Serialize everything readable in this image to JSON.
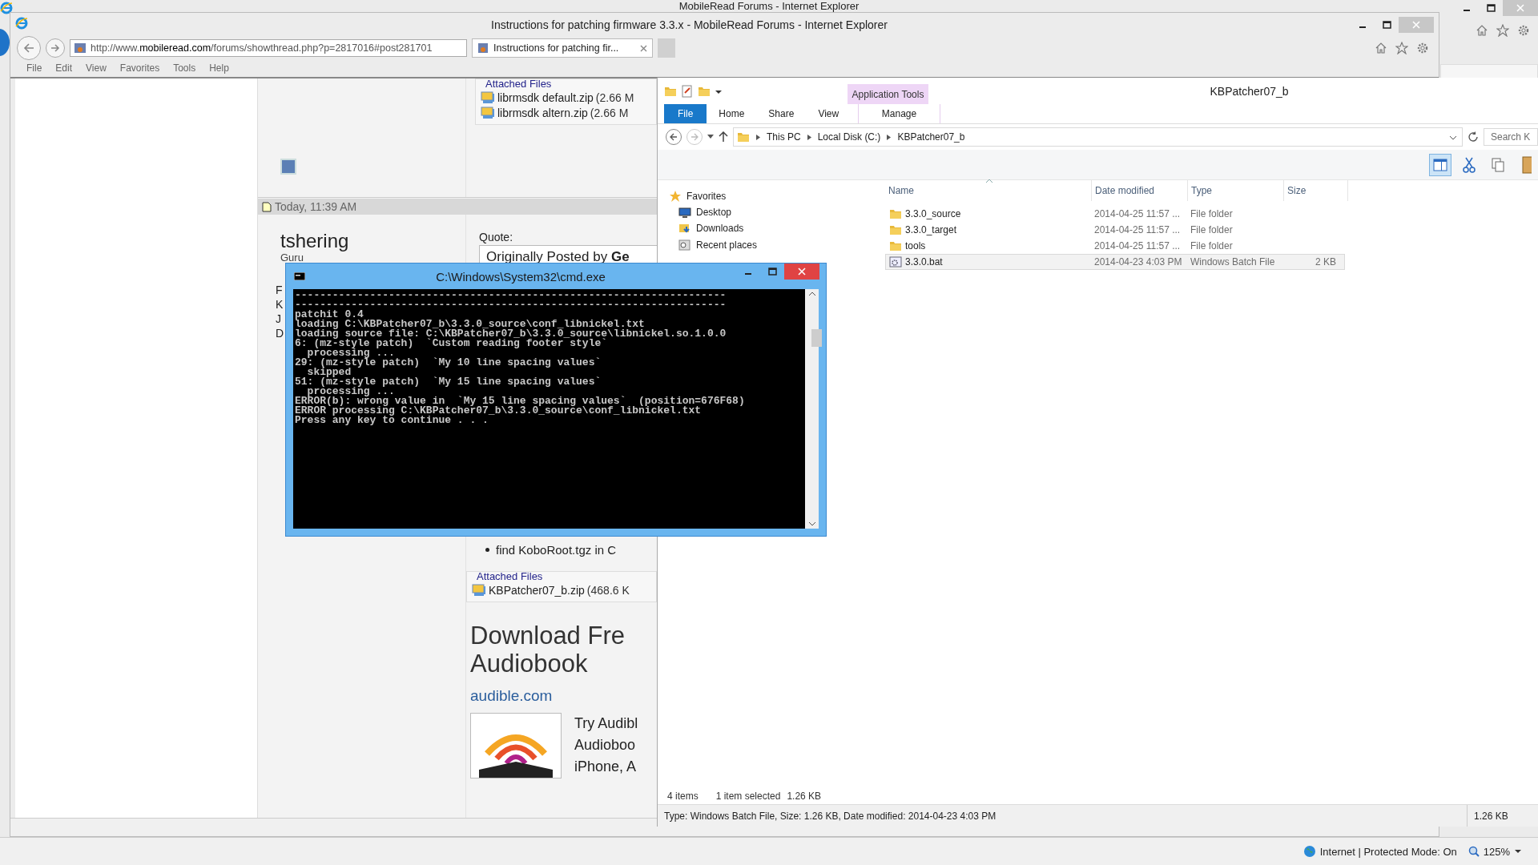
{
  "outer_window": {
    "title": "MobileRead Forums - Internet Explorer",
    "status": "Internet | Protected Mode: On",
    "zoom": "125%"
  },
  "browser": {
    "title": "Instructions for patching firmware 3.3.x - MobileRead Forums - Internet Explorer",
    "address": "http://www.**mobileread.com**/forums/showthread.php?p=2817016#post281701",
    "tabs": [
      {
        "label": "Instructions for patching fir...",
        "selected": true
      }
    ],
    "menu": [
      "File",
      "Edit",
      "View",
      "Favorites",
      "Tools",
      "Help"
    ]
  },
  "page": {
    "post1": {
      "attachments_title": "Attached Files",
      "attachments": [
        {
          "name": "librmsdk default.zip",
          "size": "(2.66 M"
        },
        {
          "name": "librmsdk altern.zip",
          "size": "(2.66 M"
        }
      ]
    },
    "post2": {
      "date": "Today, 11:39 AM",
      "user": "tshering",
      "rank": "Guru",
      "fragments": [
        "F",
        "K",
        "J",
        "D"
      ],
      "quote_label": "Quote:",
      "quote": "Originally Posted by **Ge**",
      "bullet": "find KoboRoot.tgz in C",
      "attachments_title": "Attached Files",
      "attachments": [
        {
          "name": "KBPatcher07_b.zip",
          "size": "(468.6 K"
        }
      ]
    },
    "ad": {
      "heading": [
        "Download Fre",
        "Audiobook"
      ],
      "link": "audible.com",
      "text": [
        "Try Audibl",
        "Audioboo",
        "iPhone, A"
      ]
    }
  },
  "explorer": {
    "title": "KBPatcher07_b",
    "context_tab": "Application Tools",
    "ribbon_tabs": [
      {
        "label": "File",
        "kind": "file"
      },
      {
        "label": "Home",
        "kind": "tab"
      },
      {
        "label": "Share",
        "kind": "tab"
      },
      {
        "label": "View",
        "kind": "tab"
      },
      {
        "label": "Manage",
        "kind": "context"
      }
    ],
    "breadcrumb": [
      "This PC",
      "Local Disk (C:)",
      "KBPatcher07_b"
    ],
    "search": {
      "placeholder": "Search K"
    },
    "toolbar": [
      {
        "kind": "preview",
        "selected": true
      },
      {
        "kind": "cut",
        "selected": false
      },
      {
        "kind": "copy",
        "selected": false
      },
      {
        "kind": "paste",
        "selected": false
      }
    ],
    "nav": [
      {
        "label": "Favorites",
        "kind": "favorites",
        "children": [
          {
            "label": "Desktop",
            "kind": "desktop"
          },
          {
            "label": "Downloads",
            "kind": "downloads"
          },
          {
            "label": "Recent places",
            "kind": "recent"
          }
        ]
      }
    ],
    "columns": [
      "Name",
      "Date modified",
      "Type",
      "Size"
    ],
    "files": [
      {
        "name": "3.3.0_source",
        "date": "2014-04-25 11:57 ...",
        "type": "File folder",
        "kind": "folder",
        "selected": false
      },
      {
        "name": "3.3.0_target",
        "date": "2014-04-25 11:57 ...",
        "type": "File folder",
        "kind": "folder",
        "selected": false
      },
      {
        "name": "tools",
        "date": "2014-04-25 11:57 ...",
        "type": "File folder",
        "kind": "folder",
        "selected": false
      },
      {
        "name": "3.3.0.bat",
        "date": "2014-04-23 4:03 PM",
        "type": "Windows Batch File",
        "size": "2 KB",
        "kind": "batch",
        "selected": true
      }
    ],
    "status": {
      "count": "4 items",
      "selection": "1 item selected",
      "size": "1.26 KB"
    },
    "details": {
      "text": "Type: Windows Batch File, Size: 1.26 KB, Date modified: 2014-04-23 4:03 PM",
      "size": "1.26 KB"
    }
  },
  "console": {
    "title": "C:\\Windows\\System32\\cmd.exe",
    "lines": [
      "---------------------------------------------------------------------",
      "---------------------------------------------------------------------",
      "patchit 0.4",
      "loading C:\\KBPatcher07_b\\3.3.0_source\\conf_libnickel.txt",
      "loading source file: C:\\KBPatcher07_b\\3.3.0_source\\libnickel.so.1.0.0",
      "6: (mz-style patch)  `Custom reading footer style`",
      "  processing ...",
      "29: (mz-style patch)  `My 10 line spacing values`",
      "  skipped",
      "51: (mz-style patch)  `My 15 line spacing values`",
      "  processing ...",
      "ERROR(b): wrong value in  `My 15 line spacing values`  (position=676F68)",
      "ERROR processing C:\\KBPatcher07_b\\3.3.0_source\\conf_libnickel.txt",
      "Press any key to continue . . ."
    ]
  }
}
